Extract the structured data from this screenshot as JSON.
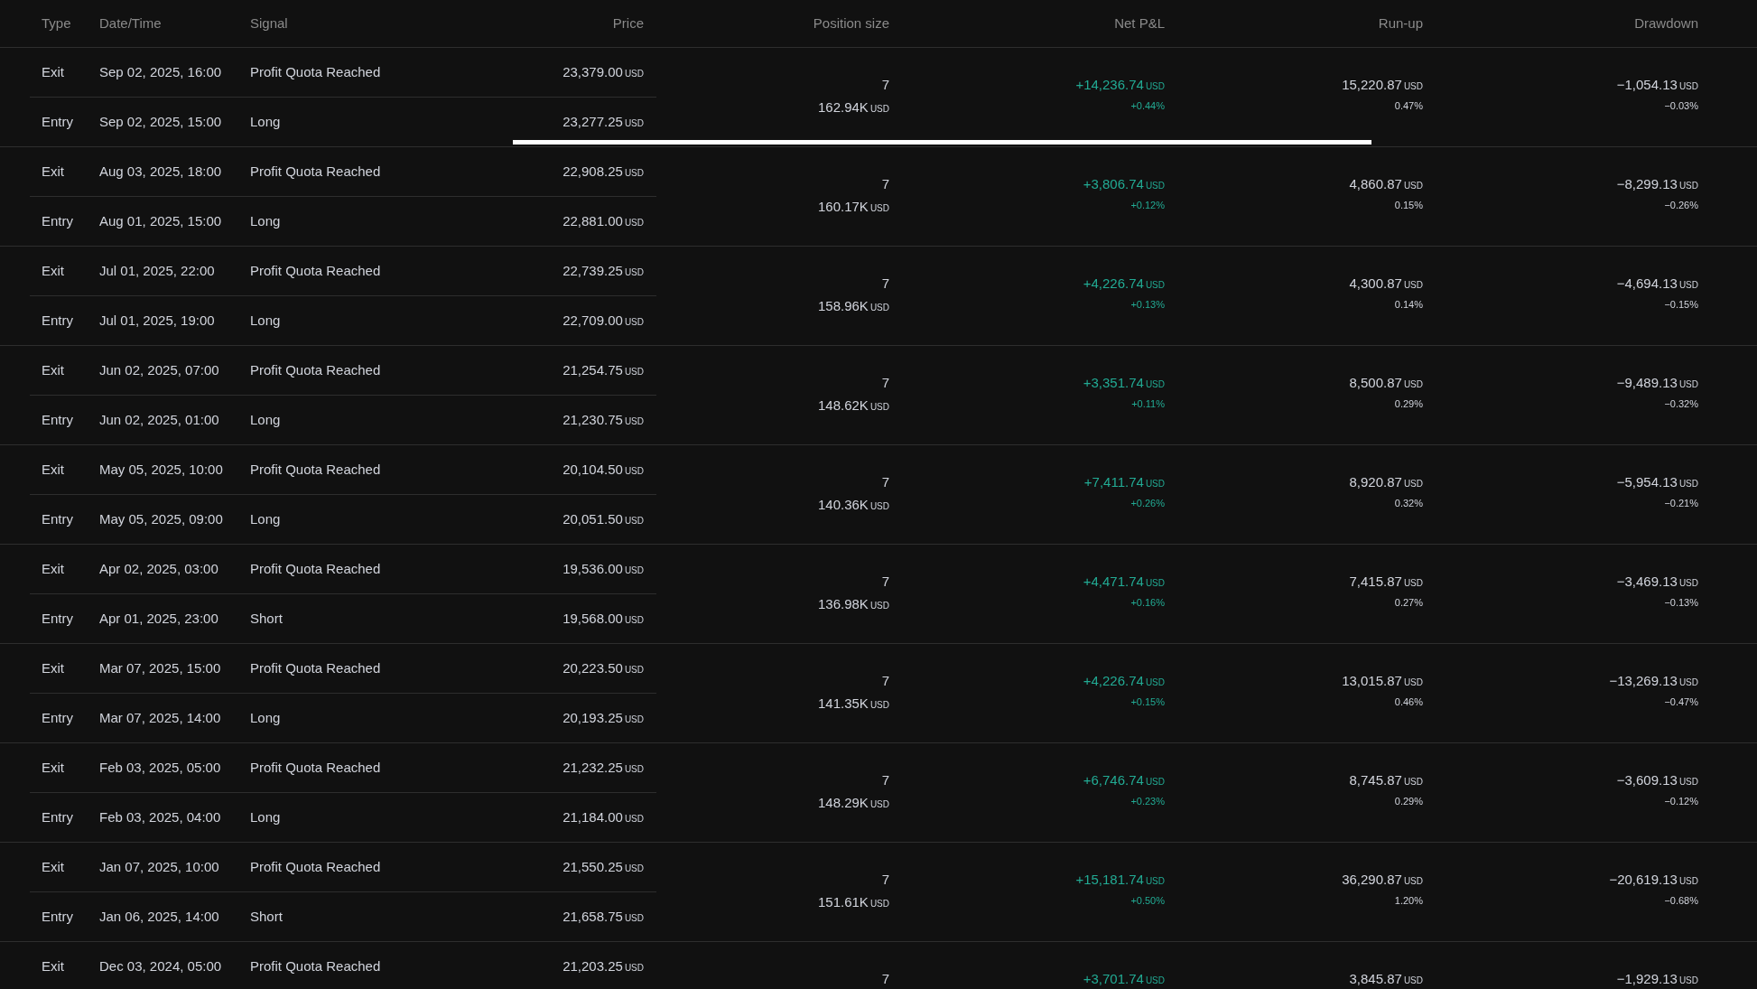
{
  "columns": [
    "Type",
    "Date/Time",
    "Signal",
    "Price",
    "Position size",
    "Net P&L",
    "Run-up",
    "Drawdown"
  ],
  "trades": [
    {
      "rows": [
        {
          "type": "Exit",
          "datetime": "Sep 02, 2025, 16:00",
          "signal": "Profit Quota Reached",
          "price": "23,379.00",
          "unit": "USD"
        },
        {
          "type": "Entry",
          "datetime": "Sep 02, 2025, 15:00",
          "signal": "Long",
          "price": "23,277.25",
          "unit": "USD"
        }
      ],
      "size": {
        "quantity": "7",
        "value": "162.94K",
        "unit": "USD"
      },
      "net_pnl": {
        "amount": "+14,236.74",
        "unit": "USD",
        "percent": "+0.44%"
      },
      "run_up": {
        "amount": "15,220.87",
        "unit": "USD",
        "percent": "0.47%"
      },
      "drawdown": {
        "amount": "−1,054.13",
        "unit": "USD",
        "percent": "−0.03%"
      }
    },
    {
      "rows": [
        {
          "type": "Exit",
          "datetime": "Aug 03, 2025, 18:00",
          "signal": "Profit Quota Reached",
          "price": "22,908.25",
          "unit": "USD"
        },
        {
          "type": "Entry",
          "datetime": "Aug 01, 2025, 15:00",
          "signal": "Long",
          "price": "22,881.00",
          "unit": "USD"
        }
      ],
      "size": {
        "quantity": "7",
        "value": "160.17K",
        "unit": "USD"
      },
      "net_pnl": {
        "amount": "+3,806.74",
        "unit": "USD",
        "percent": "+0.12%"
      },
      "run_up": {
        "amount": "4,860.87",
        "unit": "USD",
        "percent": "0.15%"
      },
      "drawdown": {
        "amount": "−8,299.13",
        "unit": "USD",
        "percent": "−0.26%"
      }
    },
    {
      "rows": [
        {
          "type": "Exit",
          "datetime": "Jul 01, 2025, 22:00",
          "signal": "Profit Quota Reached",
          "price": "22,739.25",
          "unit": "USD"
        },
        {
          "type": "Entry",
          "datetime": "Jul 01, 2025, 19:00",
          "signal": "Long",
          "price": "22,709.00",
          "unit": "USD"
        }
      ],
      "size": {
        "quantity": "7",
        "value": "158.96K",
        "unit": "USD"
      },
      "net_pnl": {
        "amount": "+4,226.74",
        "unit": "USD",
        "percent": "+0.13%"
      },
      "run_up": {
        "amount": "4,300.87",
        "unit": "USD",
        "percent": "0.14%"
      },
      "drawdown": {
        "amount": "−4,694.13",
        "unit": "USD",
        "percent": "−0.15%"
      }
    },
    {
      "rows": [
        {
          "type": "Exit",
          "datetime": "Jun 02, 2025, 07:00",
          "signal": "Profit Quota Reached",
          "price": "21,254.75",
          "unit": "USD"
        },
        {
          "type": "Entry",
          "datetime": "Jun 02, 2025, 01:00",
          "signal": "Long",
          "price": "21,230.75",
          "unit": "USD"
        }
      ],
      "size": {
        "quantity": "7",
        "value": "148.62K",
        "unit": "USD"
      },
      "net_pnl": {
        "amount": "+3,351.74",
        "unit": "USD",
        "percent": "+0.11%"
      },
      "run_up": {
        "amount": "8,500.87",
        "unit": "USD",
        "percent": "0.29%"
      },
      "drawdown": {
        "amount": "−9,489.13",
        "unit": "USD",
        "percent": "−0.32%"
      }
    },
    {
      "rows": [
        {
          "type": "Exit",
          "datetime": "May 05, 2025, 10:00",
          "signal": "Profit Quota Reached",
          "price": "20,104.50",
          "unit": "USD"
        },
        {
          "type": "Entry",
          "datetime": "May 05, 2025, 09:00",
          "signal": "Long",
          "price": "20,051.50",
          "unit": "USD"
        }
      ],
      "size": {
        "quantity": "7",
        "value": "140.36K",
        "unit": "USD"
      },
      "net_pnl": {
        "amount": "+7,411.74",
        "unit": "USD",
        "percent": "+0.26%"
      },
      "run_up": {
        "amount": "8,920.87",
        "unit": "USD",
        "percent": "0.32%"
      },
      "drawdown": {
        "amount": "−5,954.13",
        "unit": "USD",
        "percent": "−0.21%"
      }
    },
    {
      "rows": [
        {
          "type": "Exit",
          "datetime": "Apr 02, 2025, 03:00",
          "signal": "Profit Quota Reached",
          "price": "19,536.00",
          "unit": "USD"
        },
        {
          "type": "Entry",
          "datetime": "Apr 01, 2025, 23:00",
          "signal": "Short",
          "price": "19,568.00",
          "unit": "USD"
        }
      ],
      "size": {
        "quantity": "7",
        "value": "136.98K",
        "unit": "USD"
      },
      "net_pnl": {
        "amount": "+4,471.74",
        "unit": "USD",
        "percent": "+0.16%"
      },
      "run_up": {
        "amount": "7,415.87",
        "unit": "USD",
        "percent": "0.27%"
      },
      "drawdown": {
        "amount": "−3,469.13",
        "unit": "USD",
        "percent": "−0.13%"
      }
    },
    {
      "rows": [
        {
          "type": "Exit",
          "datetime": "Mar 07, 2025, 15:00",
          "signal": "Profit Quota Reached",
          "price": "20,223.50",
          "unit": "USD"
        },
        {
          "type": "Entry",
          "datetime": "Mar 07, 2025, 14:00",
          "signal": "Long",
          "price": "20,193.25",
          "unit": "USD"
        }
      ],
      "size": {
        "quantity": "7",
        "value": "141.35K",
        "unit": "USD"
      },
      "net_pnl": {
        "amount": "+4,226.74",
        "unit": "USD",
        "percent": "+0.15%"
      },
      "run_up": {
        "amount": "13,015.87",
        "unit": "USD",
        "percent": "0.46%"
      },
      "drawdown": {
        "amount": "−13,269.13",
        "unit": "USD",
        "percent": "−0.47%"
      }
    },
    {
      "rows": [
        {
          "type": "Exit",
          "datetime": "Feb 03, 2025, 05:00",
          "signal": "Profit Quota Reached",
          "price": "21,232.25",
          "unit": "USD"
        },
        {
          "type": "Entry",
          "datetime": "Feb 03, 2025, 04:00",
          "signal": "Long",
          "price": "21,184.00",
          "unit": "USD"
        }
      ],
      "size": {
        "quantity": "7",
        "value": "148.29K",
        "unit": "USD"
      },
      "net_pnl": {
        "amount": "+6,746.74",
        "unit": "USD",
        "percent": "+0.23%"
      },
      "run_up": {
        "amount": "8,745.87",
        "unit": "USD",
        "percent": "0.29%"
      },
      "drawdown": {
        "amount": "−3,609.13",
        "unit": "USD",
        "percent": "−0.12%"
      }
    },
    {
      "rows": [
        {
          "type": "Exit",
          "datetime": "Jan 07, 2025, 10:00",
          "signal": "Profit Quota Reached",
          "price": "21,550.25",
          "unit": "USD"
        },
        {
          "type": "Entry",
          "datetime": "Jan 06, 2025, 14:00",
          "signal": "Short",
          "price": "21,658.75",
          "unit": "USD"
        }
      ],
      "size": {
        "quantity": "7",
        "value": "151.61K",
        "unit": "USD"
      },
      "net_pnl": {
        "amount": "+15,181.74",
        "unit": "USD",
        "percent": "+0.50%"
      },
      "run_up": {
        "amount": "36,290.87",
        "unit": "USD",
        "percent": "1.20%"
      },
      "drawdown": {
        "amount": "−20,619.13",
        "unit": "USD",
        "percent": "−0.68%"
      }
    },
    {
      "rows": [
        {
          "type": "Exit",
          "datetime": "Dec 03, 2024, 05:00",
          "signal": "Profit Quota Reached",
          "price": "21,203.25",
          "unit": "USD"
        }
      ],
      "size": {
        "quantity": "7"
      },
      "net_pnl": {
        "amount": "+3,701.74",
        "unit": "USD"
      },
      "run_up": {
        "amount": "3,845.87",
        "unit": "USD"
      },
      "drawdown": {
        "amount": "−1,929.13",
        "unit": "USD"
      }
    }
  ]
}
